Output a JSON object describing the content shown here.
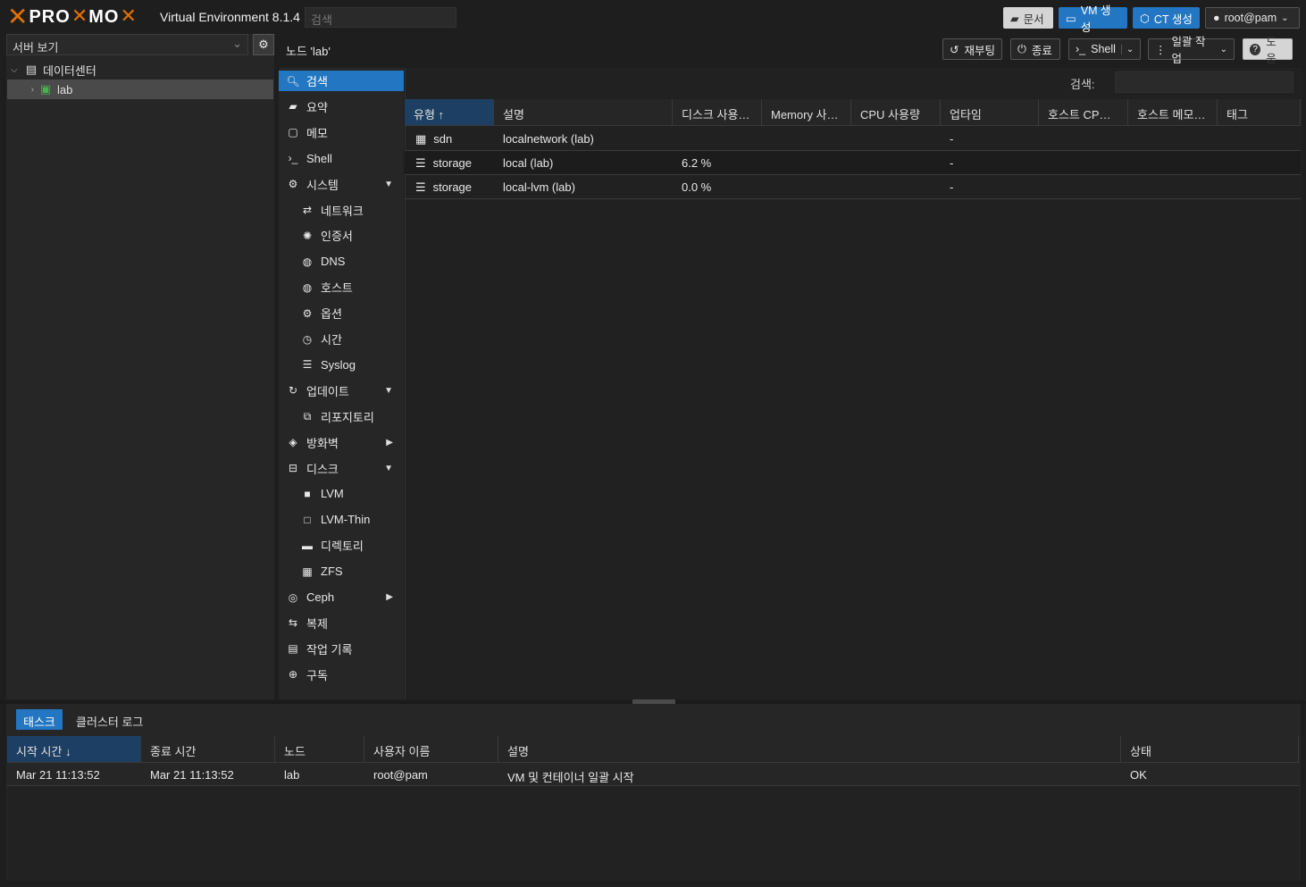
{
  "header": {
    "logo_text_1": "PRO",
    "logo_text_2": "MO",
    "product": "Virtual Environment 8.1.4",
    "search_placeholder": "검색",
    "buttons": {
      "docs": "문서",
      "create_vm": "VM 생성",
      "create_ct": "CT 생성",
      "user": "root@pam"
    }
  },
  "tree": {
    "view_label": "서버 보기",
    "items": [
      {
        "label": "데이터센터",
        "icon": "datacenter-icon"
      },
      {
        "label": "lab",
        "icon": "node-online-icon"
      }
    ]
  },
  "toolbar": {
    "breadcrumb": "노드 'lab'",
    "reboot": "재부팅",
    "shutdown": "종료",
    "shell": "Shell",
    "bulk": "일괄 작업",
    "help": "도움"
  },
  "nav": {
    "items": [
      {
        "label": "검색",
        "icon": "search-icon",
        "level": "top",
        "active": true
      },
      {
        "label": "요약",
        "icon": "book-icon",
        "level": "top"
      },
      {
        "label": "메모",
        "icon": "note-icon",
        "level": "top"
      },
      {
        "label": "Shell",
        "icon": "terminal-icon",
        "level": "top"
      },
      {
        "label": "시스템",
        "icon": "cogs-icon",
        "level": "top",
        "arrow": "▼"
      },
      {
        "label": "네트워크",
        "icon": "exchange-icon",
        "level": "sub"
      },
      {
        "label": "인증서",
        "icon": "certificate-icon",
        "level": "sub"
      },
      {
        "label": "DNS",
        "icon": "globe-icon",
        "level": "sub"
      },
      {
        "label": "호스트",
        "icon": "globe-icon",
        "level": "sub"
      },
      {
        "label": "옵션",
        "icon": "gear-icon",
        "level": "sub"
      },
      {
        "label": "시간",
        "icon": "clock-icon",
        "level": "sub"
      },
      {
        "label": "Syslog",
        "icon": "list-icon",
        "level": "sub"
      },
      {
        "label": "업데이트",
        "icon": "refresh-icon",
        "level": "top",
        "arrow": "▼"
      },
      {
        "label": "리포지토리",
        "icon": "files-icon",
        "level": "sub"
      },
      {
        "label": "방화벽",
        "icon": "shield-icon",
        "level": "top",
        "arrow": "▶"
      },
      {
        "label": "디스크",
        "icon": "hdd-icon",
        "level": "top",
        "arrow": "▼"
      },
      {
        "label": "LVM",
        "icon": "square-icon",
        "level": "sub"
      },
      {
        "label": "LVM-Thin",
        "icon": "square-outline-icon",
        "level": "sub"
      },
      {
        "label": "디렉토리",
        "icon": "folder-icon",
        "level": "sub"
      },
      {
        "label": "ZFS",
        "icon": "grid-icon",
        "level": "sub"
      },
      {
        "label": "Ceph",
        "icon": "ceph-icon",
        "level": "top",
        "arrow": "▶"
      },
      {
        "label": "복제",
        "icon": "retweet-icon",
        "level": "top"
      },
      {
        "label": "작업 기록",
        "icon": "list-alt-icon",
        "level": "top"
      },
      {
        "label": "구독",
        "icon": "support-icon",
        "level": "top"
      }
    ]
  },
  "search_panel": {
    "label": "검색:",
    "columns": [
      "유형",
      "설명",
      "디스크 사용…",
      "Memory 사…",
      "CPU 사용량",
      "업타임",
      "호스트 CP…",
      "호스트 메모…",
      "태그"
    ],
    "sort_indicator": "↑",
    "rows": [
      {
        "type": "sdn",
        "icon": "sdn-icon",
        "desc": "localnetwork (lab)",
        "disk": "",
        "uptime": "-"
      },
      {
        "type": "storage",
        "icon": "storage-icon",
        "desc": "local (lab)",
        "disk": "6.2 %",
        "uptime": "-"
      },
      {
        "type": "storage",
        "icon": "storage-icon",
        "desc": "local-lvm (lab)",
        "disk": "0.0 %",
        "uptime": "-"
      }
    ]
  },
  "bottom": {
    "tabs": [
      "태스크",
      "클러스터 로그"
    ],
    "columns": [
      "시작 시간",
      "종료 시간",
      "노드",
      "사용자 이름",
      "설명",
      "상태"
    ],
    "sort_indicator": "↓",
    "rows": [
      {
        "start": "Mar 21 11:13:52",
        "end": "Mar 21 11:13:52",
        "node": "lab",
        "user": "root@pam",
        "desc": "VM 및 컨테이너 일괄 시작",
        "status": "OK"
      }
    ]
  }
}
